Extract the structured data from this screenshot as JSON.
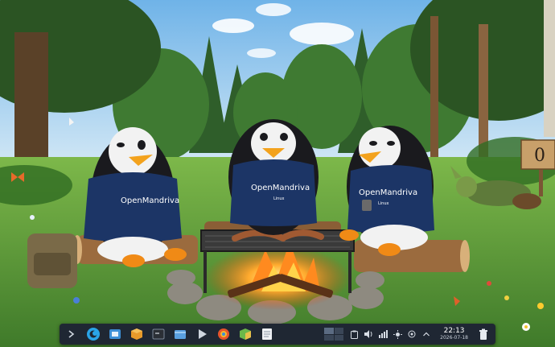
{
  "wallpaper": {
    "shirt_text": "OpenMandriva",
    "shirt_subtext": "Linux",
    "sign_text": "0"
  },
  "taskbar": {
    "apps": [
      {
        "name": "show-desktop-icon"
      },
      {
        "name": "openmandriva-menu-icon"
      },
      {
        "name": "system-settings-icon"
      },
      {
        "name": "software-center-icon"
      },
      {
        "name": "terminal-icon"
      },
      {
        "name": "file-manager-icon"
      },
      {
        "name": "media-player-icon"
      },
      {
        "name": "web-browser-icon"
      },
      {
        "name": "package-manager-icon"
      },
      {
        "name": "text-editor-icon"
      }
    ],
    "clock": {
      "time": "22:13",
      "date": "2026-07-18"
    }
  },
  "colors": {
    "taskbar_bg": "#1f2733",
    "shirt": "#1c3566",
    "accent": "#2aa4e8"
  }
}
